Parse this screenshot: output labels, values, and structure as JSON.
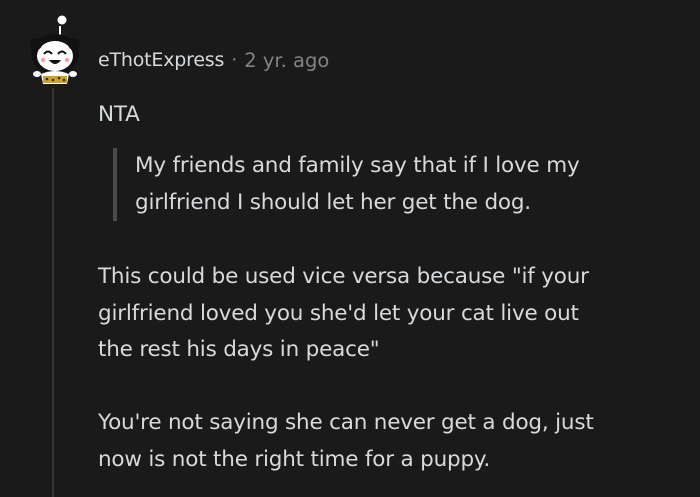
{
  "comment": {
    "author": "eThotExpress",
    "separator": "·",
    "timestamp": "2 yr. ago",
    "avatar_icon": "snoo-avatar-icon",
    "paragraphs": {
      "nta": "NTA",
      "quote_line1": "My friends and family say that if I love my",
      "quote_line2": "girlfriend I should let her get the dog.",
      "vice_line1": "This could be used vice versa because \"if your",
      "vice_line2": "girlfriend loved you she'd let your cat live out",
      "vice_line3": "the rest his days in peace\"",
      "dog_line1": "You're not saying she can never get a dog, just",
      "dog_line2": "now is not the right time for a puppy."
    }
  },
  "colors": {
    "background": "#1a1a1b",
    "text": "#d7dadc",
    "muted": "#818384",
    "thread_line": "#343536",
    "quote_bar": "#4a4b4d"
  }
}
